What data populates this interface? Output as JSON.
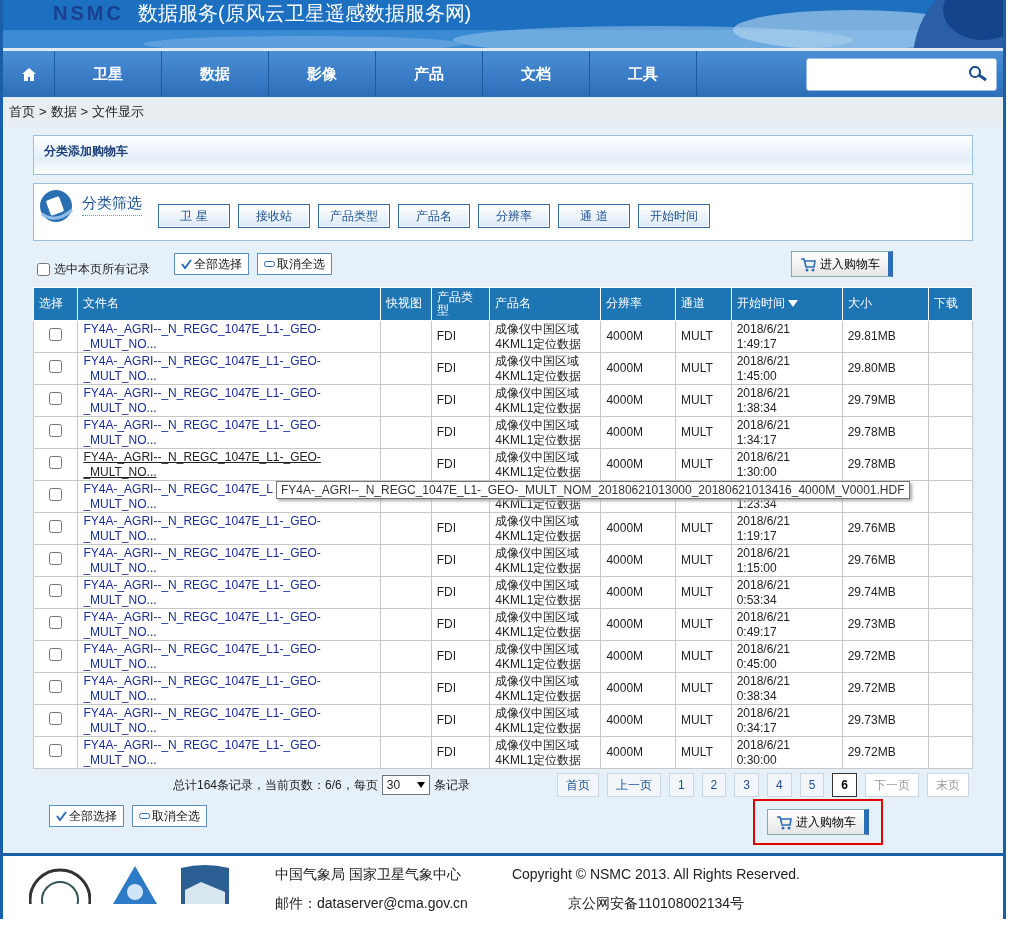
{
  "header": {
    "logo": "NSMC",
    "title": "数据服务(原风云卫星遥感数据服务网)"
  },
  "nav": {
    "items": [
      {
        "label": "卫星",
        "selected": false
      },
      {
        "label": "数据",
        "selected": false
      },
      {
        "label": "影像",
        "selected": false
      },
      {
        "label": "产品",
        "selected": false
      },
      {
        "label": "文档",
        "selected": false
      },
      {
        "label": "工具",
        "selected": false
      }
    ]
  },
  "breadcrumb": {
    "items": [
      "首页",
      "数据",
      "文件显示"
    ],
    "separator": ">"
  },
  "panel_title": "分类添加购物车",
  "filter": {
    "title": "分类筛选",
    "buttons": [
      "卫 星",
      "接收站",
      "产品类型",
      "产品名",
      "分辨率",
      "通 道",
      "开始时间"
    ]
  },
  "toolbar": {
    "select_page": {
      "label": "选中本页所有记录",
      "checked": false
    },
    "select_all": "全部选择",
    "deselect_all": "取消全选",
    "cart": "进入购物车"
  },
  "table": {
    "columns": [
      "选择",
      "文件名",
      "快视图",
      "产品类型",
      "产品名",
      "分辨率",
      "通道",
      "开始时间",
      "大小",
      "下载"
    ],
    "rows": [
      {
        "checked": false,
        "hovered": false,
        "file": [
          "FY4A-_AGRI--_N_REGC_1047E_L1-_GEO-",
          "_MULT_NO..."
        ],
        "type": "FDI",
        "product": [
          "成像仪中国区域",
          "4KML1定位数据"
        ],
        "resolution": "4000M",
        "channel": "MULT",
        "time": [
          "2018/6/21",
          "1:49:17"
        ],
        "size": "29.81MB"
      },
      {
        "checked": false,
        "hovered": false,
        "file": [
          "FY4A-_AGRI--_N_REGC_1047E_L1-_GEO-",
          "_MULT_NO..."
        ],
        "type": "FDI",
        "product": [
          "成像仪中国区域",
          "4KML1定位数据"
        ],
        "resolution": "4000M",
        "channel": "MULT",
        "time": [
          "2018/6/21",
          "1:45:00"
        ],
        "size": "29.80MB"
      },
      {
        "checked": false,
        "hovered": false,
        "file": [
          "FY4A-_AGRI--_N_REGC_1047E_L1-_GEO-",
          "_MULT_NO..."
        ],
        "type": "FDI",
        "product": [
          "成像仪中国区域",
          "4KML1定位数据"
        ],
        "resolution": "4000M",
        "channel": "MULT",
        "time": [
          "2018/6/21",
          "1:38:34"
        ],
        "size": "29.79MB"
      },
      {
        "checked": false,
        "hovered": false,
        "file": [
          "FY4A-_AGRI--_N_REGC_1047E_L1-_GEO-",
          "_MULT_NO..."
        ],
        "type": "FDI",
        "product": [
          "成像仪中国区域",
          "4KML1定位数据"
        ],
        "resolution": "4000M",
        "channel": "MULT",
        "time": [
          "2018/6/21",
          "1:34:17"
        ],
        "size": "29.78MB"
      },
      {
        "checked": false,
        "hovered": true,
        "file": [
          "FY4A-_AGRI--_N_REGC_1047E_L1-_GEO-",
          "_MULT_NO..."
        ],
        "type": "FDI",
        "product": [
          "成像仪中国区域",
          "4KML1定位数据"
        ],
        "resolution": "4000M",
        "channel": "MULT",
        "time": [
          "2018/6/21",
          "1:30:00"
        ],
        "size": "29.78MB"
      },
      {
        "checked": false,
        "hovered": false,
        "covered": true,
        "file": [
          "FY4A-_AGRI--_N_REGC_1047E_L",
          "_MULT_NO..."
        ],
        "product": [
          "4KML1定位数据"
        ],
        "time": [
          "1:23:34"
        ]
      },
      {
        "checked": false,
        "hovered": false,
        "file": [
          "FY4A-_AGRI--_N_REGC_1047E_L1-_GEO-",
          "_MULT_NO..."
        ],
        "type": "FDI",
        "product": [
          "成像仪中国区域",
          "4KML1定位数据"
        ],
        "resolution": "4000M",
        "channel": "MULT",
        "time": [
          "2018/6/21",
          "1:19:17"
        ],
        "size": "29.76MB"
      },
      {
        "checked": false,
        "hovered": false,
        "file": [
          "FY4A-_AGRI--_N_REGC_1047E_L1-_GEO-",
          "_MULT_NO..."
        ],
        "type": "FDI",
        "product": [
          "成像仪中国区域",
          "4KML1定位数据"
        ],
        "resolution": "4000M",
        "channel": "MULT",
        "time": [
          "2018/6/21",
          "1:15:00"
        ],
        "size": "29.76MB"
      },
      {
        "checked": false,
        "hovered": false,
        "file": [
          "FY4A-_AGRI--_N_REGC_1047E_L1-_GEO-",
          "_MULT_NO..."
        ],
        "type": "FDI",
        "product": [
          "成像仪中国区域",
          "4KML1定位数据"
        ],
        "resolution": "4000M",
        "channel": "MULT",
        "time": [
          "2018/6/21",
          "0:53:34"
        ],
        "size": "29.74MB"
      },
      {
        "checked": false,
        "hovered": false,
        "file": [
          "FY4A-_AGRI--_N_REGC_1047E_L1-_GEO-",
          "_MULT_NO..."
        ],
        "type": "FDI",
        "product": [
          "成像仪中国区域",
          "4KML1定位数据"
        ],
        "resolution": "4000M",
        "channel": "MULT",
        "time": [
          "2018/6/21",
          "0:49:17"
        ],
        "size": "29.73MB"
      },
      {
        "checked": false,
        "hovered": false,
        "file": [
          "FY4A-_AGRI--_N_REGC_1047E_L1-_GEO-",
          "_MULT_NO..."
        ],
        "type": "FDI",
        "product": [
          "成像仪中国区域",
          "4KML1定位数据"
        ],
        "resolution": "4000M",
        "channel": "MULT",
        "time": [
          "2018/6/21",
          "0:45:00"
        ],
        "size": "29.72MB"
      },
      {
        "checked": false,
        "hovered": false,
        "file": [
          "FY4A-_AGRI--_N_REGC_1047E_L1-_GEO-",
          "_MULT_NO..."
        ],
        "type": "FDI",
        "product": [
          "成像仪中国区域",
          "4KML1定位数据"
        ],
        "resolution": "4000M",
        "channel": "MULT",
        "time": [
          "2018/6/21",
          "0:38:34"
        ],
        "size": "29.72MB"
      },
      {
        "checked": false,
        "hovered": false,
        "file": [
          "FY4A-_AGRI--_N_REGC_1047E_L1-_GEO-",
          "_MULT_NO..."
        ],
        "type": "FDI",
        "product": [
          "成像仪中国区域",
          "4KML1定位数据"
        ],
        "resolution": "4000M",
        "channel": "MULT",
        "time": [
          "2018/6/21",
          "0:34:17"
        ],
        "size": "29.73MB"
      },
      {
        "checked": false,
        "hovered": false,
        "file": [
          "FY4A-_AGRI--_N_REGC_1047E_L1-_GEO-",
          "_MULT_NO..."
        ],
        "type": "FDI",
        "product": [
          "成像仪中国区域",
          "4KML1定位数据"
        ],
        "resolution": "4000M",
        "channel": "MULT",
        "time": [
          "2018/6/21",
          "0:30:00"
        ],
        "size": "29.72MB"
      }
    ]
  },
  "tooltip": "FY4A-_AGRI--_N_REGC_1047E_L1-_GEO-_MULT_NOM_20180621013000_20180621013416_4000M_V0001.HDF",
  "summary": {
    "before": "总计164条记录，当前页数：6/6，每页",
    "per_page": "30",
    "after": "条记录"
  },
  "pagination": [
    {
      "label": "首页",
      "selected": false,
      "disabled": false
    },
    {
      "label": "上一页",
      "selected": false,
      "disabled": false
    },
    {
      "label": "1",
      "selected": false,
      "disabled": false
    },
    {
      "label": "2",
      "selected": false,
      "disabled": false
    },
    {
      "label": "3",
      "selected": false,
      "disabled": false
    },
    {
      "label": "4",
      "selected": false,
      "disabled": false
    },
    {
      "label": "5",
      "selected": false,
      "disabled": false
    },
    {
      "label": "6",
      "selected": true,
      "disabled": false
    },
    {
      "label": "下一页",
      "selected": false,
      "disabled": true
    },
    {
      "label": "末页",
      "selected": false,
      "disabled": true
    }
  ],
  "bottom": {
    "select_all": "全部选择",
    "deselect_all": "取消全选",
    "cart": "进入购物车",
    "highlighted": true
  },
  "footer": {
    "org": "中国气象局 国家卫星气象中心",
    "email": "邮件：dataserver@cma.gov.cn",
    "copyright": "Copyright © NSMC 2013. All Rights Reserved.",
    "record": "京公网安备110108002134号"
  }
}
